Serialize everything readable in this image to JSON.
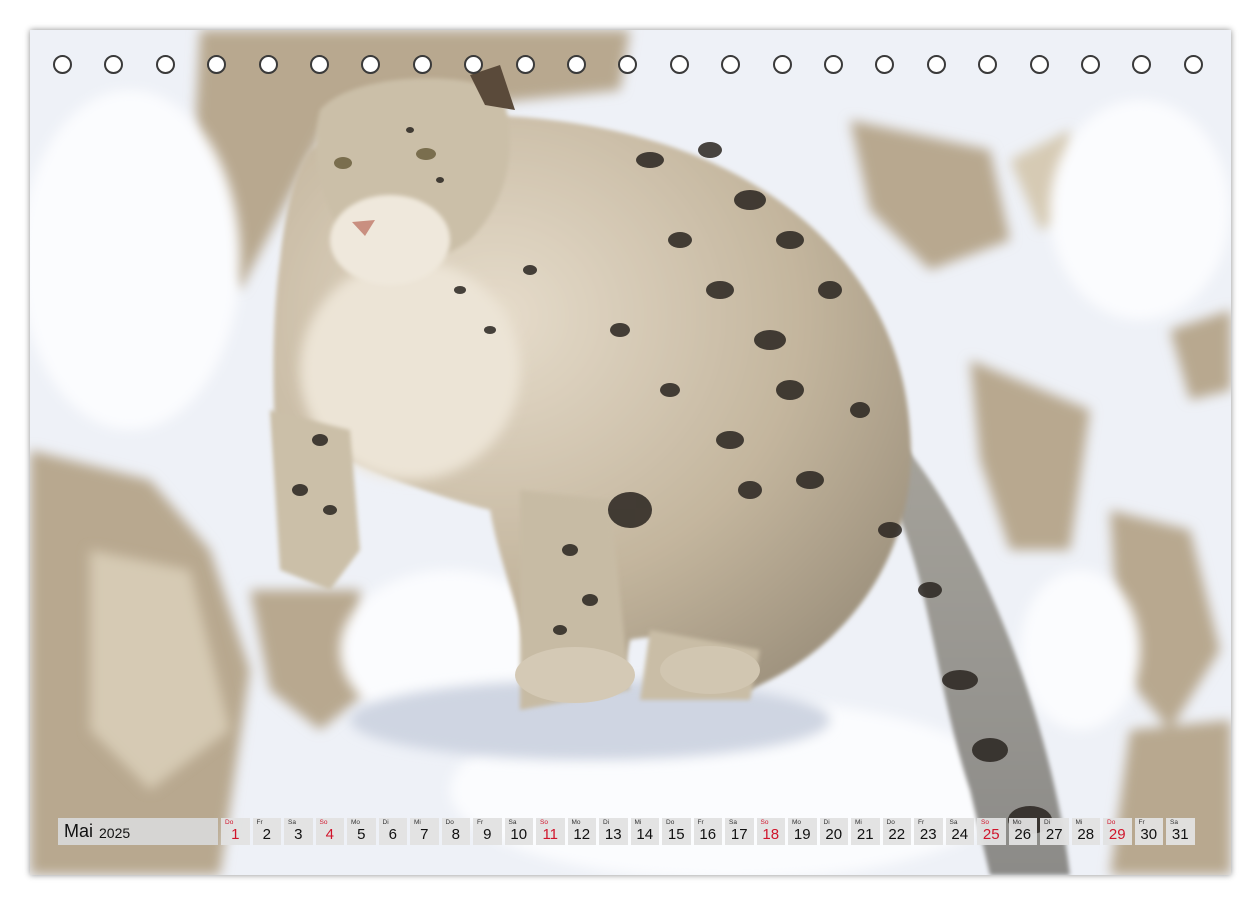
{
  "calendar": {
    "month": "Mai",
    "year": "2025",
    "days": [
      {
        "wd": "Do",
        "num": "1",
        "red": true
      },
      {
        "wd": "Fr",
        "num": "2"
      },
      {
        "wd": "Sa",
        "num": "3"
      },
      {
        "wd": "So",
        "num": "4",
        "red": true
      },
      {
        "wd": "Mo",
        "num": "5"
      },
      {
        "wd": "Di",
        "num": "6"
      },
      {
        "wd": "Mi",
        "num": "7"
      },
      {
        "wd": "Do",
        "num": "8"
      },
      {
        "wd": "Fr",
        "num": "9"
      },
      {
        "wd": "Sa",
        "num": "10"
      },
      {
        "wd": "So",
        "num": "11",
        "red": true
      },
      {
        "wd": "Mo",
        "num": "12"
      },
      {
        "wd": "Di",
        "num": "13"
      },
      {
        "wd": "Mi",
        "num": "14"
      },
      {
        "wd": "Do",
        "num": "15"
      },
      {
        "wd": "Fr",
        "num": "16"
      },
      {
        "wd": "Sa",
        "num": "17"
      },
      {
        "wd": "So",
        "num": "18",
        "red": true
      },
      {
        "wd": "Mo",
        "num": "19"
      },
      {
        "wd": "Di",
        "num": "20"
      },
      {
        "wd": "Mi",
        "num": "21"
      },
      {
        "wd": "Do",
        "num": "22"
      },
      {
        "wd": "Fr",
        "num": "23"
      },
      {
        "wd": "Sa",
        "num": "24"
      },
      {
        "wd": "So",
        "num": "25",
        "red": true
      },
      {
        "wd": "Mo",
        "num": "26"
      },
      {
        "wd": "Di",
        "num": "27"
      },
      {
        "wd": "Mi",
        "num": "28"
      },
      {
        "wd": "Do",
        "num": "29",
        "red": true
      },
      {
        "wd": "Fr",
        "num": "30"
      },
      {
        "wd": "Sa",
        "num": "31"
      }
    ]
  },
  "binding_hole_count": 23,
  "colors": {
    "holiday_red": "#d0142b",
    "strip_gray": "#d7d7d7",
    "snow": "#f3f5f9",
    "rock": "#b9a88f",
    "fur": "#c9b89c"
  },
  "photo": {
    "subject_icon": "snow-leopard-photo"
  }
}
